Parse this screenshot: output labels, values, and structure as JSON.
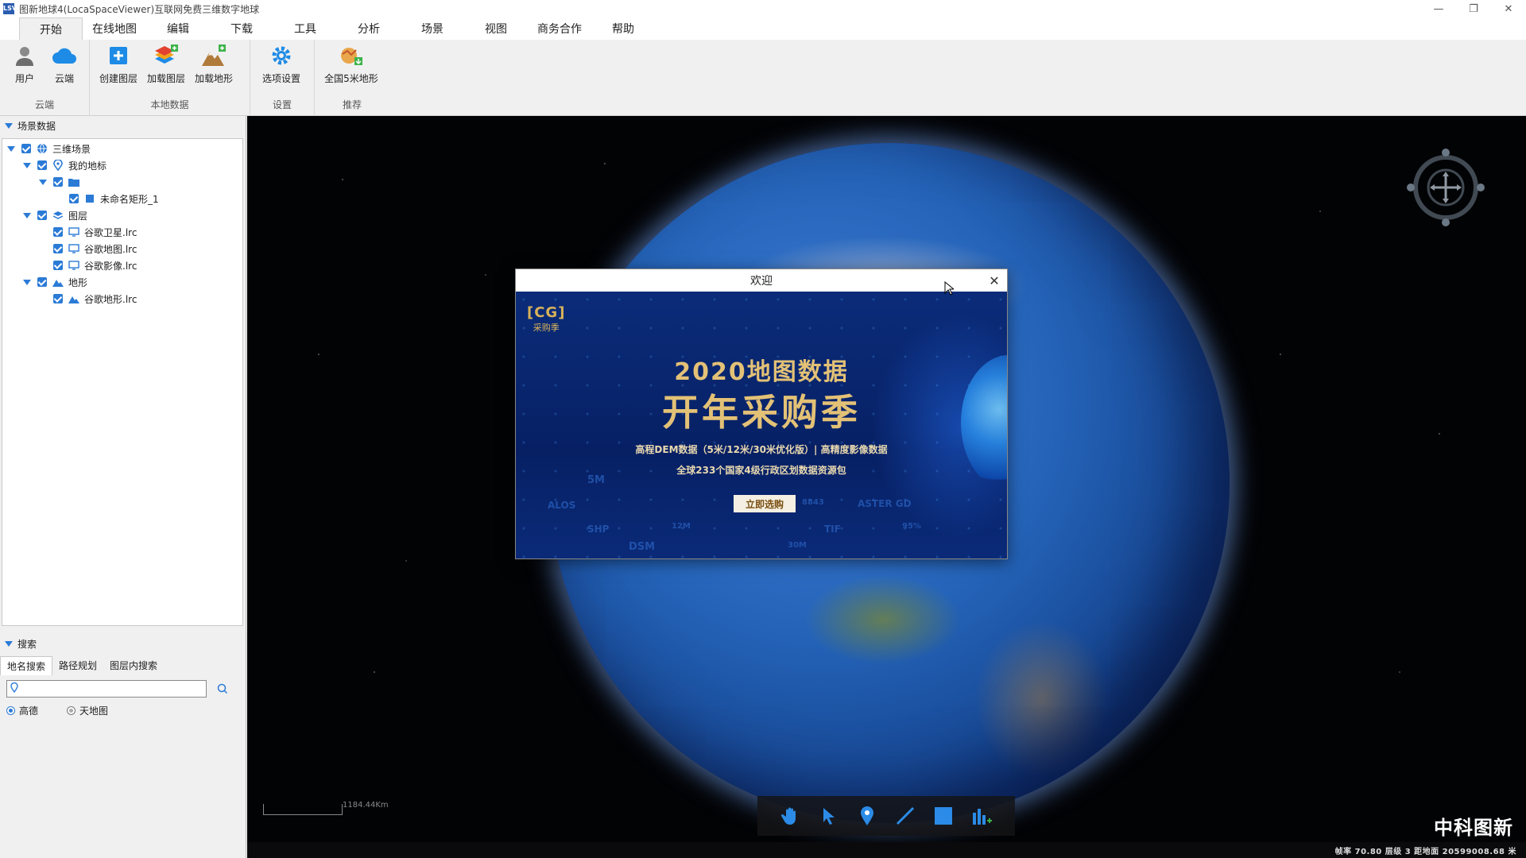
{
  "window": {
    "title": "图新地球4(LocaSpaceViewer)互联网免费三维数字地球",
    "icon_text": "LSV",
    "controls": {
      "minimize": "—",
      "restore": "❐",
      "close": "✕"
    }
  },
  "menu": {
    "tabs": [
      {
        "label": "开始",
        "active": true
      },
      {
        "label": "在线地图"
      },
      {
        "label": "编辑"
      },
      {
        "label": "下载"
      },
      {
        "label": "工具"
      },
      {
        "label": "分析"
      },
      {
        "label": "场景"
      },
      {
        "label": "视图"
      },
      {
        "label": "商务合作"
      },
      {
        "label": "帮助"
      }
    ]
  },
  "ribbon": {
    "groups": [
      {
        "label": "云端",
        "buttons": [
          {
            "label": "用户",
            "icon": "user-icon"
          },
          {
            "label": "云端",
            "icon": "cloud-icon"
          }
        ]
      },
      {
        "label": "本地数据",
        "buttons": [
          {
            "label": "创建图层",
            "icon": "create-layer-icon"
          },
          {
            "label": "加载图层",
            "icon": "load-layer-icon"
          },
          {
            "label": "加载地形",
            "icon": "load-terrain-icon"
          }
        ]
      },
      {
        "label": "设置",
        "buttons": [
          {
            "label": "选项设置",
            "icon": "gear-icon"
          }
        ]
      },
      {
        "label": "推荐",
        "buttons": [
          {
            "label": "全国5米地形",
            "icon": "terrain-5m-icon"
          }
        ]
      }
    ]
  },
  "scene_panel": {
    "header": "场景数据",
    "tree": {
      "root": "三维场景",
      "my_places": "我的地标",
      "rect": "未命名矩形_1",
      "layers": "图层",
      "layer1": "谷歌卫星.lrc",
      "layer2": "谷歌地图.lrc",
      "layer3": "谷歌影像.lrc",
      "terrain": "地形",
      "terrain1": "谷歌地形.lrc"
    }
  },
  "search_panel": {
    "header": "搜索",
    "tabs": [
      {
        "label": "地名搜索",
        "active": true
      },
      {
        "label": "路径规划"
      },
      {
        "label": "图层内搜索"
      }
    ],
    "input_value": "",
    "input_placeholder": "",
    "providers": [
      {
        "label": "高德",
        "selected": true
      },
      {
        "label": "天地图",
        "selected": false
      }
    ]
  },
  "viewport": {
    "scale_text": "1184.44Km",
    "brand": "中科图新",
    "status": "帧率 70.80  层级 3  距地面 20599008.68 米",
    "accent": "#2b7bd6"
  },
  "dialog": {
    "title": "欢迎",
    "close": "✕",
    "logo_top": "[CG]",
    "logo_bottom": "采购季",
    "headline1": "2020地图数据",
    "headline2": "开年采购季",
    "sub1": "高程DEM数据（5米/12米/30米优化版）| 高精度影像数据",
    "sub2": "全球233个国家4级行政区划数据资源包",
    "button": "立即选购",
    "keywords": [
      "5M",
      "ALOS",
      "SHP",
      "DSM",
      "12M",
      "30M",
      "TIF",
      "ASTER GD",
      "95%",
      "8843"
    ]
  }
}
